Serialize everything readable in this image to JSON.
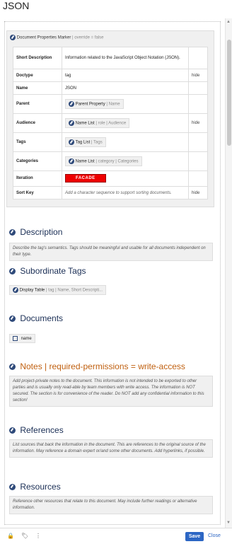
{
  "page": {
    "title": "JSON"
  },
  "marker": {
    "title": "Document Properties Marker",
    "override": "| override = false"
  },
  "properties": [
    {
      "key": "Short Description",
      "value": "Information related to the JavaScript Object Notation (JSON).",
      "type": "text",
      "flag": ""
    },
    {
      "key": "Doctype",
      "value": "tag",
      "type": "text",
      "flag": "hide"
    },
    {
      "key": "Name",
      "value": "JSON",
      "type": "text",
      "flag": ""
    },
    {
      "key": "Parent",
      "value": "Parent Property",
      "extra": "| Name",
      "type": "ref",
      "flag": ""
    },
    {
      "key": "Audience",
      "value": "Name List",
      "extra": "| role | Audience",
      "type": "ref",
      "flag": "hide"
    },
    {
      "key": "Tags",
      "value": "Tag List",
      "extra": "| Tags",
      "type": "ref",
      "flag": ""
    },
    {
      "key": "Categories",
      "value": "Name List",
      "extra": "| category | Categories",
      "type": "ref",
      "flag": ""
    },
    {
      "key": "Iteration",
      "value": "FACADE",
      "type": "facade",
      "flag": ""
    },
    {
      "key": "Sort Key",
      "value": "Add a character sequence to support sorting documents.",
      "type": "hint",
      "flag": "hide"
    }
  ],
  "sections": {
    "description": {
      "title": "Description",
      "text": "Describe the tag's semantics. Tags should be meaningful and usable for all documents independent on their type."
    },
    "subordinate": {
      "title": "Subordinate Tags",
      "chip": "Display Table",
      "chip_extra": "| tag | Name, Short Descripti..."
    },
    "documents": {
      "title": "Documents",
      "chip": "name"
    },
    "notes": {
      "title": "Notes | required-permissions = write-access",
      "text": "Add project-private notes to the document. This information is not intended to be exported to other parties and is usually only read-able by team members with write access. The information is NOT secured. The section is for convenience of the reader. Do NOT add any confidential information to this section!"
    },
    "references": {
      "title": "References",
      "text": "List sources that back the information in the document. This are references to the original source of the information. May reference a domain expert or/and some other documents. Add hyperlinks, if possible."
    },
    "resources": {
      "title": "Resources",
      "text": "Reference other resources that relate to this document. May include further readings or alternative information."
    }
  },
  "toolbar": {
    "save_label": "Save",
    "close_label": "Close"
  },
  "colors": {
    "accent": "#2c66c4",
    "notes_title": "#c06010",
    "facade": "#ee0000"
  }
}
